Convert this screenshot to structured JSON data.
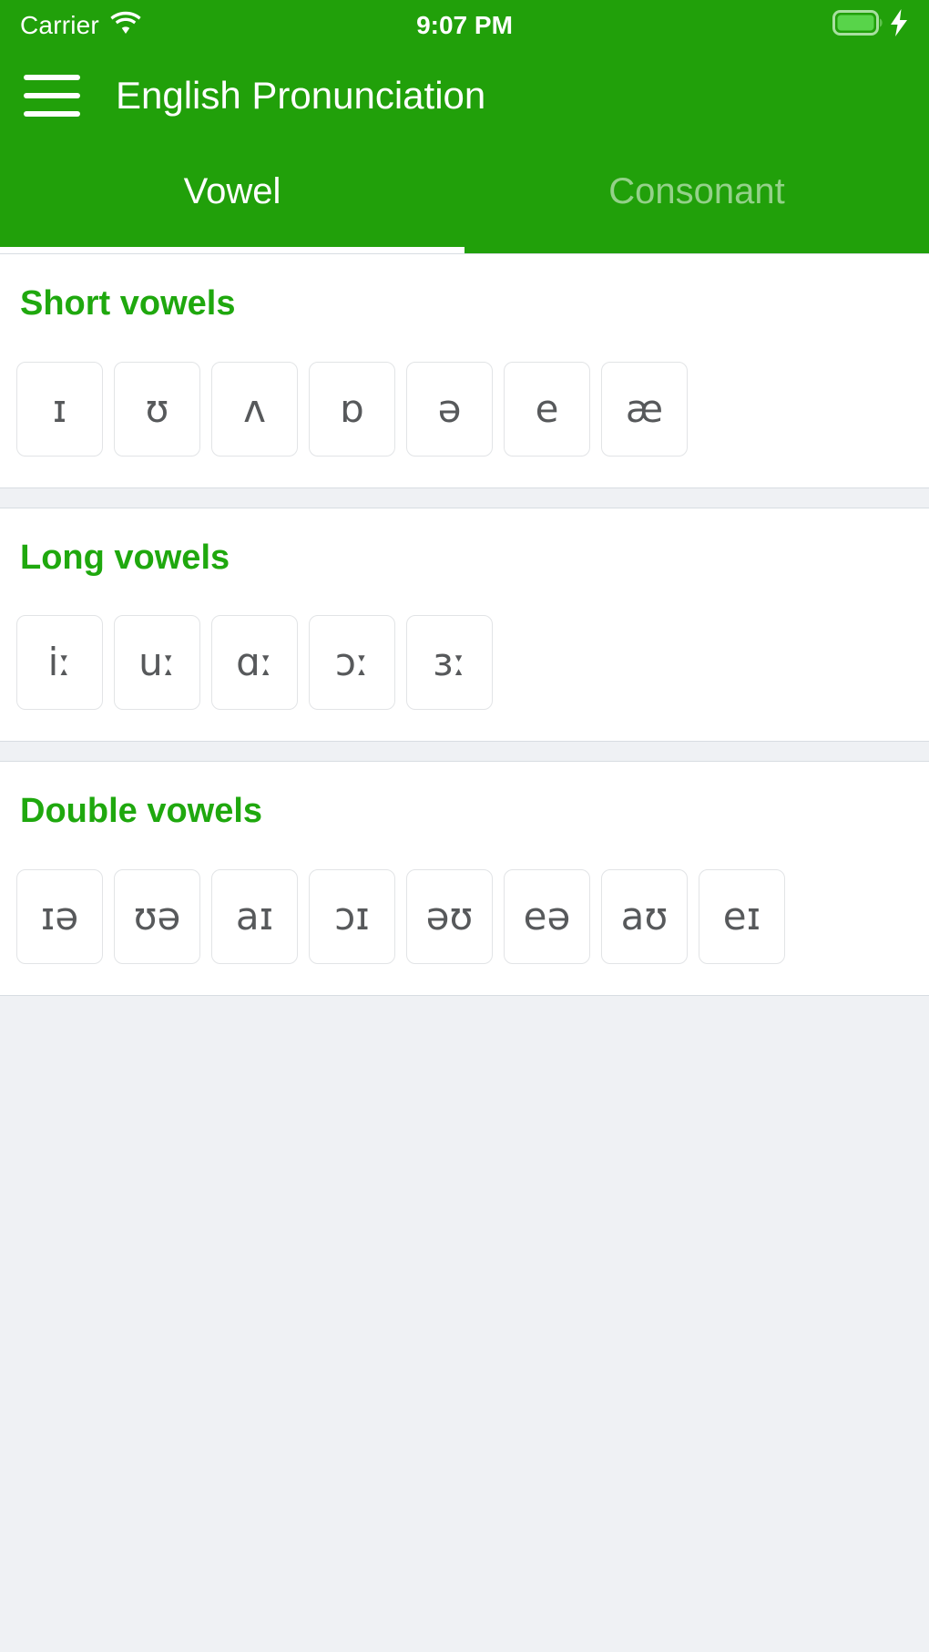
{
  "status_bar": {
    "carrier": "Carrier",
    "time": "9:07 PM",
    "wifi_icon": "wifi-icon",
    "battery_icon": "battery-full-icon",
    "charging_icon": "lightning-bolt-icon"
  },
  "nav": {
    "menu_icon": "hamburger-menu-icon",
    "title": "English Pronunciation"
  },
  "tabs": [
    {
      "label": "Vowel",
      "active": true
    },
    {
      "label": "Consonant",
      "active": false
    }
  ],
  "colors": {
    "header_green": "#21a00a",
    "title_green": "#1fa80e",
    "page_background": "#eff1f4",
    "card_background": "#ffffff",
    "tile_border": "#e2e4e6",
    "symbol_gray": "#57595b",
    "tab_inactive": "rgba(255,255,255,0.52)"
  },
  "sections": [
    {
      "title": "Short vowels",
      "symbols": [
        "ɪ",
        "ʊ",
        "ʌ",
        "ɒ",
        "ə",
        "e",
        "æ"
      ]
    },
    {
      "title": "Long vowels",
      "symbols": [
        "iː",
        "uː",
        "ɑː",
        "ɔː",
        "ɜː"
      ]
    },
    {
      "title": "Double vowels",
      "symbols": [
        "ɪə",
        "ʊə",
        "aɪ",
        "ɔɪ",
        "əʊ",
        "eə",
        "aʊ",
        "eɪ"
      ]
    }
  ]
}
